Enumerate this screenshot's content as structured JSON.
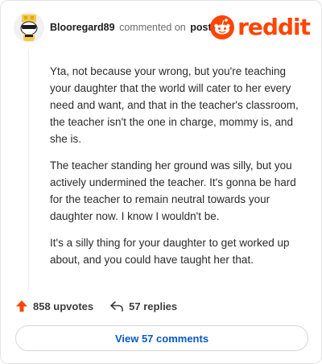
{
  "header": {
    "username": "Blooregard89",
    "action_text": "commented on",
    "link_text": "post",
    "logo_text": "reddit"
  },
  "comment": {
    "paragraphs": [
      "Yta, not because your wrong, but you're teaching your daughter that the world will cater to her every need and want, and that in the teacher's classroom, the teacher isn't the one in charge, mommy is, and she is.",
      "The teacher standing her ground was silly, but you actively undermined the teacher. It's gonna be hard for the teacher to remain neutral towards your daughter now. I know I wouldn't be.",
      "It's a silly thing for your daughter to get worked up about, and you could have taught her that."
    ]
  },
  "actions": {
    "upvotes_label": "858 upvotes",
    "replies_label": "57 replies"
  },
  "footer": {
    "view_comments_label": "View 57 comments"
  },
  "colors": {
    "brand": "#ff4500",
    "link": "#0a57c2",
    "text": "#1c1c1c",
    "muted": "#6b6b6b"
  }
}
